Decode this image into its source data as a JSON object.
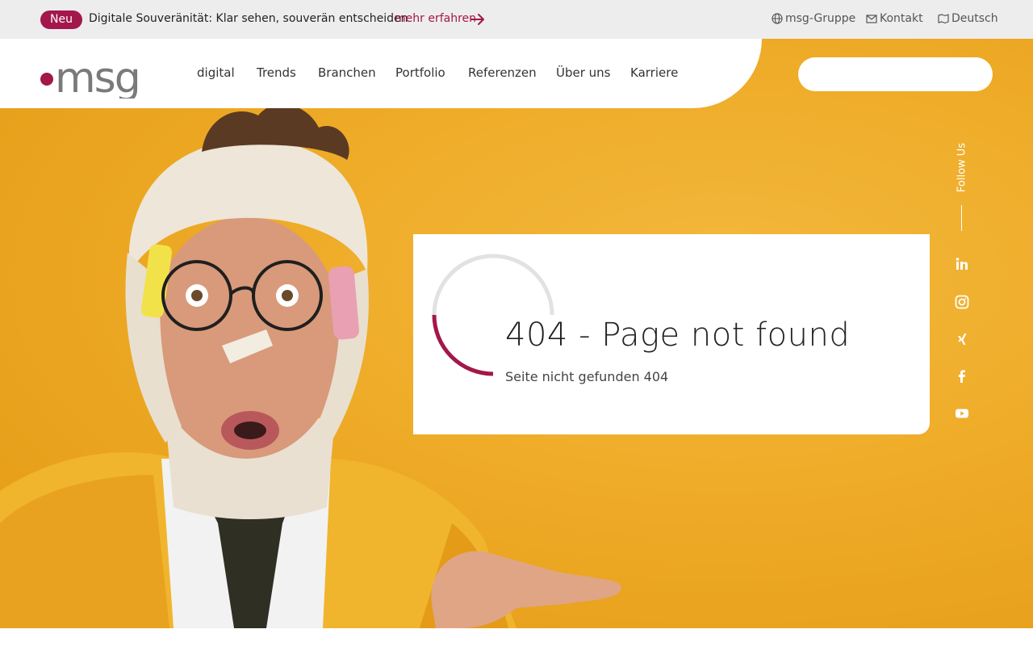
{
  "announcement": {
    "badge": "Neu",
    "text": "Digitale Souveränität: Klar sehen, souverän entscheiden",
    "link": "mehr erfahren"
  },
  "utility": {
    "group": "msg-Gruppe",
    "contact": "Kontakt",
    "language": "Deutsch"
  },
  "logo": {
    "text": ".msg"
  },
  "nav": [
    "digital",
    "Trends",
    "Branchen",
    "Portfolio",
    "Referenzen",
    "Über uns",
    "Karriere"
  ],
  "search": {
    "placeholder": ""
  },
  "follow": {
    "label": "Follow Us"
  },
  "social": [
    "linkedin-icon",
    "instagram-icon",
    "xing-icon",
    "facebook-icon",
    "youtube-icon"
  ],
  "error": {
    "title": "404 - Page not found",
    "subtitle": "Seite nicht gefunden 404"
  },
  "colors": {
    "accent": "#a3174a",
    "hero": "#eeab27",
    "topbar": "#ededed"
  }
}
